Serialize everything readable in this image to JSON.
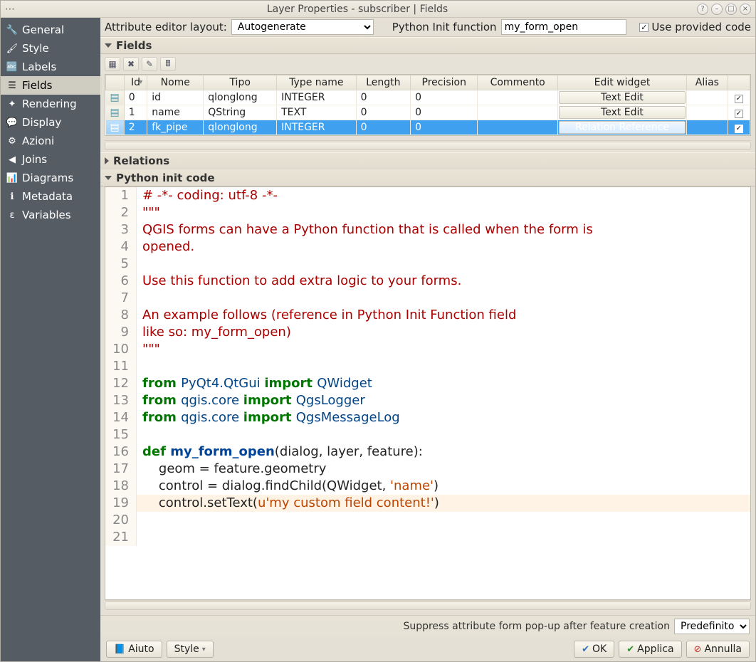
{
  "titlebar": {
    "title": "Layer Properties - subscriber | Fields"
  },
  "sidebar": {
    "items": [
      {
        "label": "General",
        "icon": "🔧"
      },
      {
        "label": "Style",
        "icon": "🖌"
      },
      {
        "label": "Labels",
        "icon": "🔤"
      },
      {
        "label": "Fields",
        "icon": "☰",
        "selected": true
      },
      {
        "label": "Rendering",
        "icon": "✦"
      },
      {
        "label": "Display",
        "icon": "💬"
      },
      {
        "label": "Azioni",
        "icon": "⚙"
      },
      {
        "label": "Joins",
        "icon": "◀"
      },
      {
        "label": "Diagrams",
        "icon": "📊"
      },
      {
        "label": "Metadata",
        "icon": "ℹ"
      },
      {
        "label": "Variables",
        "icon": "ε"
      }
    ]
  },
  "toolbar": {
    "attr_editor_label": "Attribute editor layout:",
    "attr_editor_value": "Autogenerate",
    "python_init_label": "Python Init function",
    "python_init_value": "my_form_open",
    "use_provided_label": "Use provided code"
  },
  "sections": {
    "fields": "Fields",
    "relations": "Relations",
    "pycode": "Python init code"
  },
  "fields_toolbar": {
    "b1": "new-field",
    "b2": "delete-field",
    "b3": "edit-field",
    "b4": "field-calculator"
  },
  "grid": {
    "headers": [
      "Id",
      "Nome",
      "Tipo",
      "Type name",
      "Length",
      "Precision",
      "Commento",
      "Edit widget",
      "Alias",
      ""
    ],
    "rows": [
      {
        "id": "0",
        "nome": "id",
        "tipo": "qlonglong",
        "tname": "INTEGER",
        "len": "0",
        "prec": "0",
        "comm": "",
        "widget": "Text Edit",
        "alias": "",
        "sel": false
      },
      {
        "id": "1",
        "nome": "name",
        "tipo": "QString",
        "tname": "TEXT",
        "len": "0",
        "prec": "0",
        "comm": "",
        "widget": "Text Edit",
        "alias": "",
        "sel": false
      },
      {
        "id": "2",
        "nome": "fk_pipe",
        "tipo": "qlonglong",
        "tname": "INTEGER",
        "len": "0",
        "prec": "0",
        "comm": "",
        "widget": "Relation Reference",
        "alias": "",
        "sel": true
      }
    ]
  },
  "code_lines": [
    [
      {
        "t": "# -*- coding: utf-8 -*-",
        "c": "k-red"
      }
    ],
    [
      {
        "t": "\"\"\"",
        "c": "k-red"
      }
    ],
    [
      {
        "t": "QGIS forms can have a Python function that is called when the form is",
        "c": "k-red"
      }
    ],
    [
      {
        "t": "opened.",
        "c": "k-red"
      }
    ],
    [
      {
        "t": "",
        "c": ""
      }
    ],
    [
      {
        "t": "Use this function to add extra logic to your forms.",
        "c": "k-red"
      }
    ],
    [
      {
        "t": "",
        "c": ""
      }
    ],
    [
      {
        "t": "An example follows (reference in Python Init Function field",
        "c": "k-red"
      }
    ],
    [
      {
        "t": "like so: my_form_open)",
        "c": "k-red"
      }
    ],
    [
      {
        "t": "\"\"\"",
        "c": "k-red"
      }
    ],
    [
      {
        "t": "",
        "c": ""
      }
    ],
    [
      {
        "t": "from ",
        "c": "k-green"
      },
      {
        "t": "PyQt4.QtGui ",
        "c": "k-teal"
      },
      {
        "t": "import ",
        "c": "k-green"
      },
      {
        "t": "QWidget",
        "c": "k-teal"
      }
    ],
    [
      {
        "t": "from ",
        "c": "k-green"
      },
      {
        "t": "qgis.core ",
        "c": "k-teal"
      },
      {
        "t": "import ",
        "c": "k-green"
      },
      {
        "t": "QgsLogger",
        "c": "k-teal"
      }
    ],
    [
      {
        "t": "from ",
        "c": "k-green"
      },
      {
        "t": "qgis.core ",
        "c": "k-teal"
      },
      {
        "t": "import ",
        "c": "k-green"
      },
      {
        "t": "QgsMessageLog",
        "c": "k-teal"
      }
    ],
    [
      {
        "t": "",
        "c": ""
      }
    ],
    [
      {
        "t": "def ",
        "c": "k-green"
      },
      {
        "t": "my_form_open",
        "c": "k-blue"
      },
      {
        "t": "(dialog, layer, feature):",
        "c": ""
      }
    ],
    [
      {
        "t": "    geom = feature.geometry",
        "c": ""
      }
    ],
    [
      {
        "t": "    control = dialog.findChild(QWidget, ",
        "c": ""
      },
      {
        "t": "'name'",
        "c": "k-str"
      },
      {
        "t": ")",
        "c": ""
      }
    ],
    [
      {
        "t": "    control.setText(",
        "c": ""
      },
      {
        "t": "u'my custom field content!'",
        "c": "k-str"
      },
      {
        "t": ")",
        "c": ""
      }
    ],
    [
      {
        "t": "",
        "c": ""
      }
    ],
    [
      {
        "t": "",
        "c": ""
      }
    ]
  ],
  "highlight_line": 19,
  "footer": {
    "suppress_label": "Suppress attribute form pop-up after feature creation",
    "suppress_value": "Predefinito"
  },
  "buttons": {
    "aiuto": "Aiuto",
    "style": "Style",
    "ok": "OK",
    "applica": "Applica",
    "annulla": "Annulla"
  }
}
